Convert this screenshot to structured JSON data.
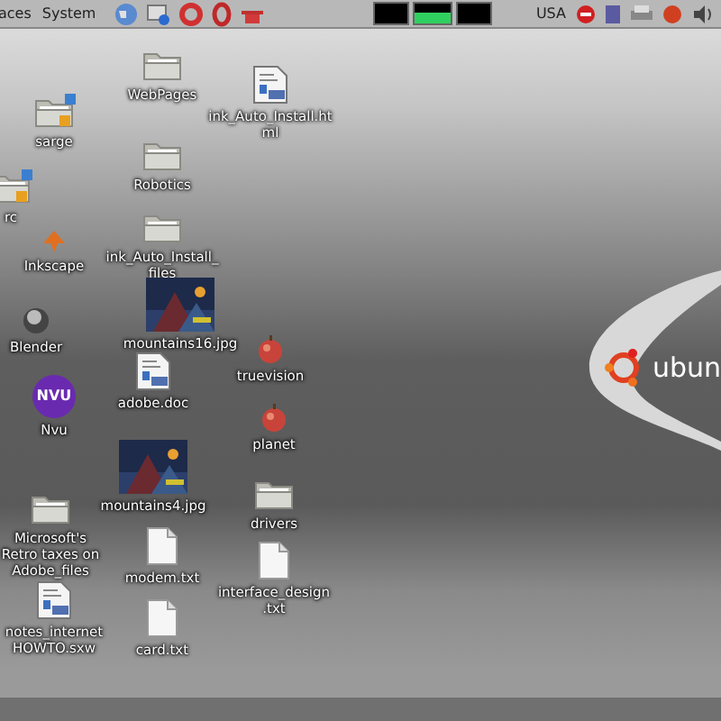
{
  "top_panel": {
    "menus": [
      "aces",
      "System"
    ],
    "keyboard": "USA"
  },
  "desktop": {
    "icons": [
      {
        "label": "WebPages",
        "kind": "folder"
      },
      {
        "label": "sarge",
        "kind": "shared-folder"
      },
      {
        "label": "ink_Auto_Install.html",
        "kind": "html"
      },
      {
        "label": "Robotics",
        "kind": "folder"
      },
      {
        "label": "rc",
        "kind": "shared-folder"
      },
      {
        "label": "Inkscape",
        "kind": "inkscape"
      },
      {
        "label": "ink_Auto_Install_files",
        "kind": "folder"
      },
      {
        "label": "Blender",
        "kind": "blender"
      },
      {
        "label": "mountains16.jpg"
      },
      {
        "label": "truevision",
        "kind": "apple"
      },
      {
        "label": "adobe.doc",
        "kind": "html"
      },
      {
        "label": "Nvu",
        "kind": "nvu",
        "badge": "NVU"
      },
      {
        "label": "planet",
        "kind": "apple"
      },
      {
        "label": "mountains4.jpg"
      },
      {
        "label": "drivers",
        "kind": "folder"
      },
      {
        "label": "Microsoft's Retro taxes on Adobe_files",
        "kind": "folder"
      },
      {
        "label": "modem.txt",
        "kind": "text"
      },
      {
        "label": "interface_design.txt",
        "kind": "text"
      },
      {
        "label": "notes_internet HOWTO.sxw",
        "kind": "html"
      },
      {
        "label": "card.txt",
        "kind": "text"
      }
    ]
  },
  "wallpaper": {
    "logo_text": "ubun"
  }
}
